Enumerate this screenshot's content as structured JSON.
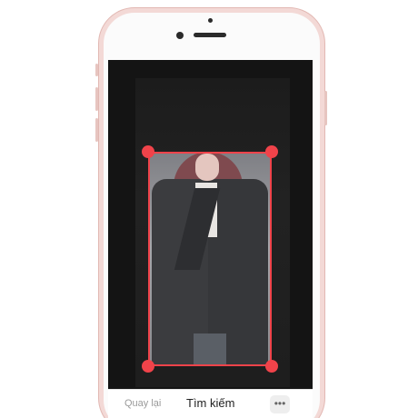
{
  "bottom_bar": {
    "back_label": "Quay lại",
    "title": "Tìm kiếm",
    "more_icon": "more-horizontal-icon"
  },
  "colors": {
    "accent": "#f0434a",
    "screen_background": "#141414",
    "phone_body": "#f3d9d6"
  }
}
